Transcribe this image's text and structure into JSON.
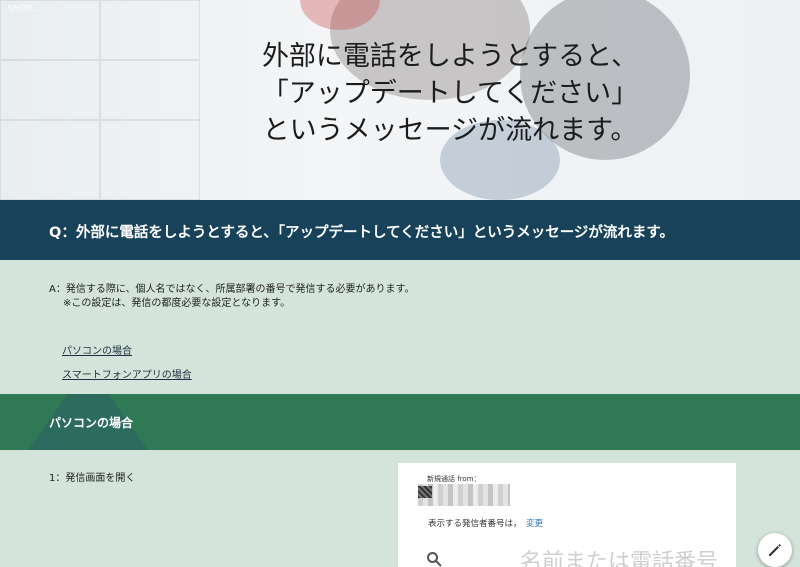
{
  "site": {
    "logo_text": "SHOP…"
  },
  "hero": {
    "title_lines": [
      "外部に電話をしようとすると、",
      "「アップデートしてください」",
      "というメッセージが流れます。"
    ]
  },
  "question": {
    "text": "Q：外部に電話をしようとすると、「アップデートしてください」というメッセージが流れます。"
  },
  "answer": {
    "line1": "A：発信する際に、個人名ではなく、所属部署の番号で発信する必要があります。",
    "line2": "※この設定は、発信の都度必要な設定となります。",
    "links": [
      "パソコンの場合",
      "スマートフォンアプリの場合"
    ]
  },
  "section": {
    "title": "パソコンの場合"
  },
  "steps": [
    {
      "label": "1：発信画面を開く"
    }
  ],
  "screenshot_panel": {
    "from_label": "新規通話 from：",
    "display_text": "表示する発信者番号は，",
    "change_link": "変更",
    "search_placeholder": "名前または電話番号"
  },
  "icons": {
    "edit": "pencil-icon",
    "search": "search-icon"
  },
  "colors": {
    "question_band": "#17425a",
    "section_band": "#2f7a54",
    "page_bg": "#d4e4db",
    "link": "#2f79c0"
  }
}
